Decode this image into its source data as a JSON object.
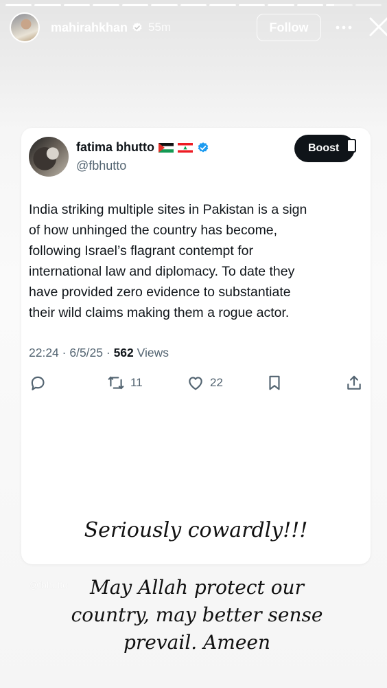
{
  "story": {
    "progress": [
      1,
      1,
      1,
      1,
      1,
      1,
      1,
      1,
      1,
      1,
      1,
      0.3,
      0
    ],
    "username": "mahirahkhan",
    "time": "55m",
    "follow_label": "Follow"
  },
  "tweet": {
    "name": "fatima bhutto",
    "flags": [
      "palestine-flag",
      "lebanon-flag"
    ],
    "handle": "@fbhutto",
    "boost_label": "Boost",
    "text": "India striking multiple sites in Pakistan is a sign\nof how unhinged the country has become,\nfollowing Israel’s flagrant contempt for\ninternational law and diplomacy. To date they\nhave provided zero evidence to substantiate\ntheir wild claims making them a rogue actor.",
    "meta_prefix": "22:24 · 6/5/25 · ",
    "views_count": "562",
    "views_label": "Views",
    "retweets": "11",
    "likes": "22"
  },
  "captions": {
    "inside": "Seriously cowardly!!!",
    "watermark": "@fbhutto",
    "bottom": "May Allah protect our\ncountry, may better sense\nprevail. Ameen"
  },
  "colors": {
    "verified": "#1d9bf0",
    "tweet_text": "#0f1419",
    "tweet_muted": "#536471"
  }
}
